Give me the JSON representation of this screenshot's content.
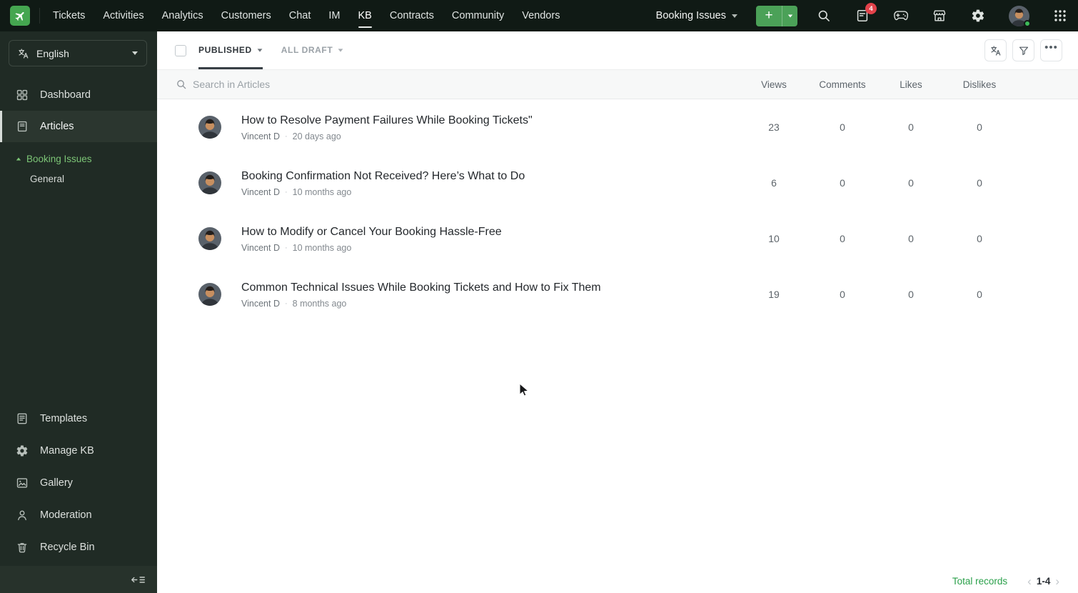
{
  "topbar": {
    "nav": [
      {
        "label": "Tickets"
      },
      {
        "label": "Activities"
      },
      {
        "label": "Analytics"
      },
      {
        "label": "Customers"
      },
      {
        "label": "Chat"
      },
      {
        "label": "IM"
      },
      {
        "label": "KB"
      },
      {
        "label": "Contracts"
      },
      {
        "label": "Community"
      },
      {
        "label": "Vendors"
      }
    ],
    "department_label": "Booking Issues",
    "add_label": "+",
    "notification_count": "4"
  },
  "sidebar": {
    "language_label": "English",
    "items": [
      {
        "label": "Dashboard"
      },
      {
        "label": "Articles"
      }
    ],
    "category": {
      "label": "Booking Issues",
      "child": "General"
    },
    "tools": [
      {
        "label": "Templates"
      },
      {
        "label": "Manage KB"
      },
      {
        "label": "Gallery"
      },
      {
        "label": "Moderation"
      },
      {
        "label": "Recycle Bin"
      }
    ]
  },
  "main": {
    "tabs": [
      {
        "label": "PUBLISHED"
      },
      {
        "label": "ALL DRAFT"
      }
    ],
    "search_placeholder": "Search in Articles",
    "columns": [
      "Views",
      "Comments",
      "Likes",
      "Dislikes"
    ],
    "separator": "·",
    "articles": [
      {
        "title": "How to Resolve Payment Failures While Booking Tickets\"",
        "author": "Vincent D",
        "time": "20 days ago",
        "views": "23",
        "comments": "0",
        "likes": "0",
        "dislikes": "0"
      },
      {
        "title": "Booking Confirmation Not Received? Here’s What to Do",
        "author": "Vincent D",
        "time": "10 months ago",
        "views": "6",
        "comments": "0",
        "likes": "0",
        "dislikes": "0"
      },
      {
        "title": "How to Modify or Cancel Your Booking Hassle-Free",
        "author": "Vincent D",
        "time": "10 months ago",
        "views": "10",
        "comments": "0",
        "likes": "0",
        "dislikes": "0"
      },
      {
        "title": "Common Technical Issues While Booking Tickets and How to Fix Them",
        "author": "Vincent D",
        "time": "8 months ago",
        "views": "19",
        "comments": "0",
        "likes": "0",
        "dislikes": "0"
      }
    ],
    "footer": {
      "total_label": "Total records",
      "range": "1-4"
    }
  },
  "colors": {
    "topbar_bg": "#101a15",
    "sidebar_bg": "#202b25",
    "accent_green": "#4ba158",
    "sidebar_link_green": "#7cc576",
    "badge_red": "#e2424a",
    "footer_green": "#2aa04a"
  },
  "icons": {
    "logo": "airplane",
    "language": "translate",
    "dashboard": "grid-2x2",
    "articles": "notebook",
    "templates": "document-lines",
    "manage_kb": "gear",
    "gallery": "image",
    "moderation": "person",
    "recycle_bin": "trash",
    "collapse": "arrow-left-lines",
    "search": "magnifier",
    "notifications": "feed-document",
    "games": "game-controller",
    "marketplace": "storefront",
    "settings": "gear",
    "apps": "grid-3x3-dots",
    "filter": "funnel",
    "more": "ellipsis",
    "pager_prev": "chevron-left",
    "pager_next": "chevron-right"
  }
}
